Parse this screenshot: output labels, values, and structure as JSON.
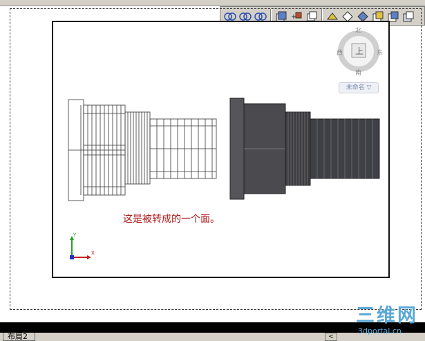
{
  "viewcube": {
    "face_label": "上",
    "north": "北",
    "south": "南",
    "east": "东",
    "west": "西"
  },
  "named_view": "未命名 ▽",
  "caption": "这是被转成的一个面。",
  "ucs": {
    "x_label": "X",
    "y_label": "Y"
  },
  "layout_tab": "布局2",
  "scroll_left": "<",
  "watermark": {
    "text": "三维网",
    "url": "3dportal.cn"
  },
  "toolbar_icons": [
    "orbit-icon",
    "free-orbit-icon",
    "continuous-orbit-icon",
    "view-top-icon",
    "view-bottom-icon",
    "view-left-icon",
    "view-right-icon",
    "view-front-icon",
    "view-back-icon",
    "view-sw-iso-icon",
    "view-se-iso-icon",
    "view-ne-iso-icon",
    "view-nw-iso-icon"
  ],
  "colors": {
    "caption": "#b01c1c",
    "watermark": "#5aa8d8",
    "part_solid": "#4a4a4f"
  }
}
